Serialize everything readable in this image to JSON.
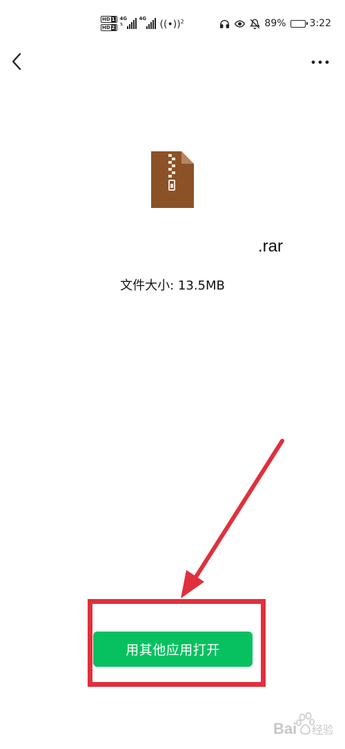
{
  "status_bar": {
    "hd_badge_1": "HD",
    "hd_badge_1_sub": "1",
    "hd_badge_2": "HD",
    "hd_badge_2_sub": "2",
    "network_1": "4G",
    "network_2": "4G",
    "hotspot_count": "2",
    "battery": "89%",
    "battery_level": 0.89,
    "time": "3:22"
  },
  "nav": {
    "back_icon": "chevron-left-icon",
    "more_icon": "more-horizontal-icon"
  },
  "file": {
    "icon": "archive-zip-icon",
    "icon_color": "#8b5228",
    "icon_fold_color": "#b5865f",
    "name_suffix": ".rar",
    "size_text": "文件大小: 13.5MB"
  },
  "actions": {
    "open_with_other_app": "用其他应用打开",
    "button_color": "#07c160"
  },
  "annotation": {
    "highlight_color": "#e0303c"
  },
  "watermark": {
    "text": "Bai",
    "text_tail": "经验"
  }
}
